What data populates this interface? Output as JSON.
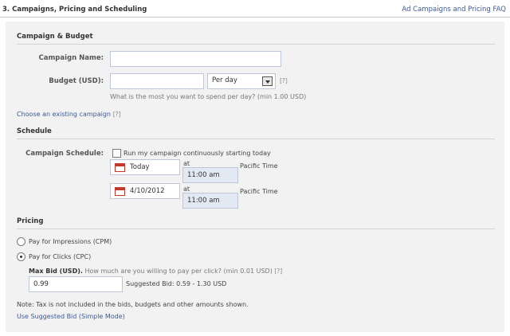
{
  "header": {
    "title": "3. Campaigns, Pricing and Scheduling",
    "faq_link": "Ad Campaigns and Pricing FAQ"
  },
  "campaign_budget": {
    "title": "Campaign & Budget",
    "campaign_name_label": "Campaign Name:",
    "campaign_name_value": "",
    "budget_label": "Budget (USD):",
    "budget_value": "",
    "period_selected": "Per day",
    "help": "[?]",
    "hint": "What is the most you want to spend per day? (min 1.00 USD)",
    "existing_campaign_link": "Choose an existing campaign",
    "existing_campaign_help": "[?]"
  },
  "schedule": {
    "title": "Schedule",
    "campaign_schedule_label": "Campaign Schedule:",
    "run_continuously_label": "Run my campaign continuously starting today",
    "run_continuously_checked": false,
    "start": {
      "date": "Today",
      "at": "at",
      "time": "11:00 am",
      "timezone": "Pacific Time"
    },
    "end": {
      "date": "4/10/2012",
      "at": "at",
      "time": "11:00 am",
      "timezone": "Pacific Time"
    }
  },
  "pricing": {
    "title": "Pricing",
    "option_cpm": "Pay for Impressions (CPM)",
    "option_cpc": "Pay for Clicks (CPC)",
    "selected": "cpc",
    "max_bid_label": "Max Bid (USD).",
    "max_bid_hint": "How much are you willing to pay per click? (min 0.01 USD)",
    "max_bid_help": "[?]",
    "max_bid_value": "0.99",
    "suggested_bid": "Suggested Bid: 0.59 - 1.30 USD",
    "tax_note": "Note: Tax is not included in the bids, budgets and other amounts shown.",
    "use_suggested_link": "Use Suggested Bid (Simple Mode)"
  }
}
